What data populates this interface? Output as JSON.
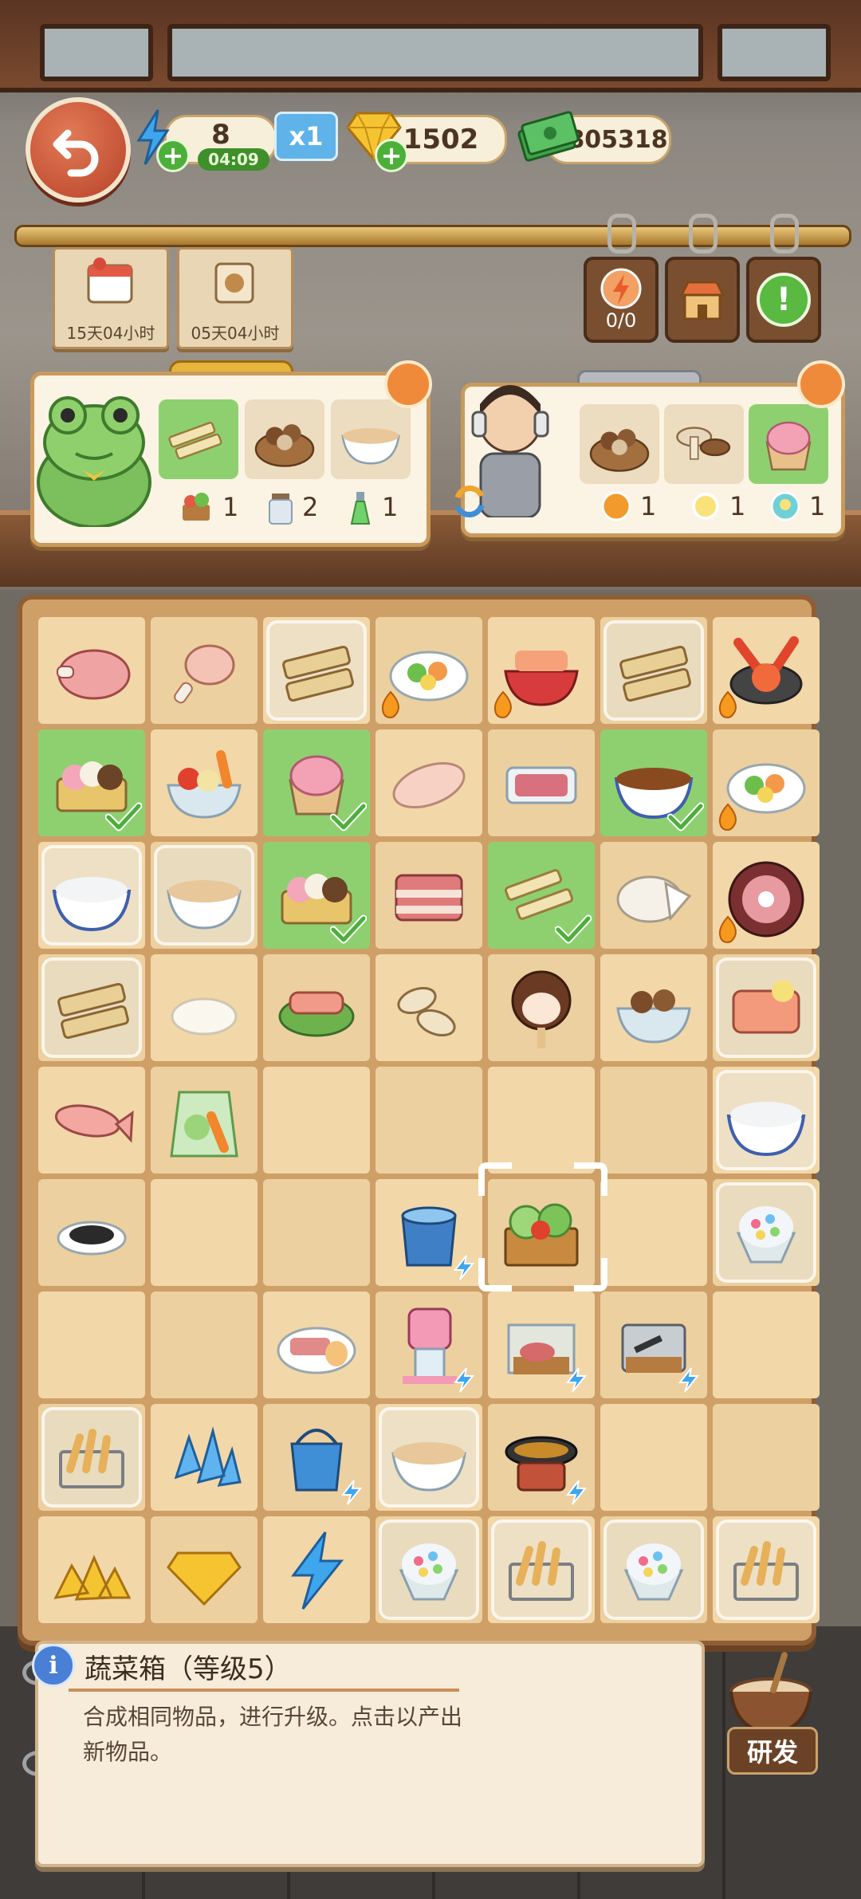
{
  "status": {
    "energy": "8",
    "energy_timer": "04:09",
    "multiplier": "x1",
    "gems": "1502",
    "cash": "805318"
  },
  "tickets": [
    {
      "label": "15天04小时"
    },
    {
      "label": "05天04小时"
    }
  ],
  "hang_tags": [
    {
      "label": "0/0",
      "icon": "energy-icon"
    },
    {
      "label": "",
      "icon": "shop-icon"
    },
    {
      "label": "",
      "icon": "exclamation-icon"
    }
  ],
  "orders": {
    "frog": {
      "requests": [
        "tofu-strips",
        "mushroom-basket",
        "noodle-bowl"
      ],
      "rewards": [
        {
          "icon": "vegetable-basket-icon",
          "count": "1"
        },
        {
          "icon": "jar-icon",
          "count": "2"
        },
        {
          "icon": "green-bottle-icon",
          "count": "1"
        }
      ]
    },
    "singer": {
      "requests": [
        "mushroom-basket",
        "mushroom-pile",
        "strawberry-ice-cream"
      ],
      "rewards": [
        {
          "icon": "orange-orb-icon",
          "count": "1"
        },
        {
          "icon": "yellow-orb-icon",
          "count": "1"
        },
        {
          "icon": "bulb-icon",
          "count": "1"
        }
      ]
    }
  },
  "board": {
    "rows": [
      [
        "ham",
        "drumstick",
        "toast-glass",
        "salad-fire",
        "sashimi-fire",
        "toast-glass",
        "lobster-fire"
      ],
      [
        "icecream-box-done",
        "veg-bowl",
        "strawberry-cup-done",
        "chicken-breast",
        "meat-pack",
        "braised-bowl-done",
        "salad-fire"
      ],
      [
        "sugar-bowl-glass",
        "noodle-bowl-glass",
        "icecream-box-done",
        "pork-belly",
        "tofu-done",
        "rice-cake",
        "meat-platter-fire"
      ],
      [
        "toast-glass",
        "rice",
        "salmon-leaf",
        "seeds",
        "popsicle",
        "mushroom-bowl",
        "salmon-glass"
      ],
      [
        "fish",
        "veg-bag",
        "",
        "",
        "",
        "",
        "sugar-bowl-glass"
      ],
      [
        "black-sesame",
        "",
        "",
        "water-bucket-gen",
        "veg-crate-selected",
        "",
        "shaved-ice-glass"
      ],
      [
        "",
        "",
        "bacon-egg",
        "ice-machine-gen",
        "meat-board-gen",
        "knife-tray-gen",
        ""
      ],
      [
        "fries-basket-glass",
        "ice-crystals",
        "bucket-gen",
        "noodle-bowl-glass",
        "fryer-gen",
        "",
        ""
      ],
      [
        "gold-pile",
        "gold-gem",
        "lightning",
        "shaved-ice-glass",
        "fries-basket-glass",
        "shaved-ice-glass",
        "fries-basket-glass"
      ]
    ]
  },
  "info": {
    "icon": "i",
    "title": "蔬菜箱（等级5）",
    "description": "合成相同物品，进行升级。点击以产出新物品。"
  },
  "research_label": "研发",
  "colors": {
    "accent_green": "#8ed070",
    "board_bg": "#cf9f68",
    "cell": "#f2d7a9",
    "back_button": "#c8532f"
  }
}
